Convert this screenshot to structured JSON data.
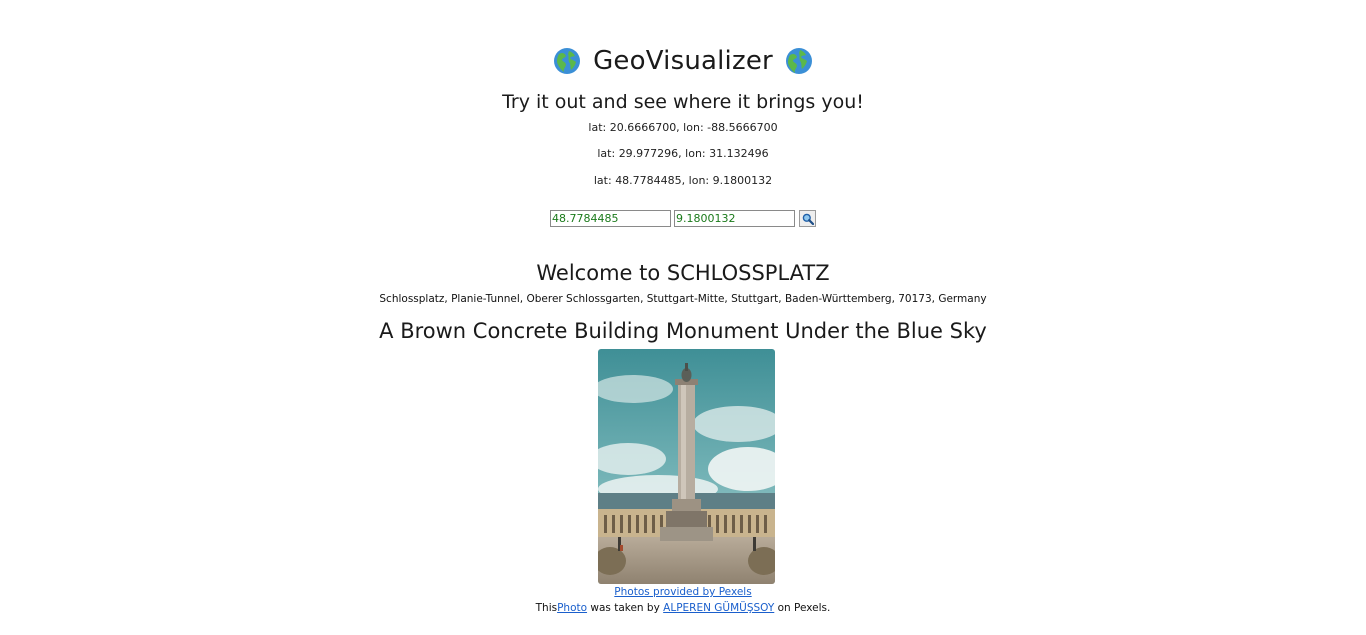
{
  "header": {
    "title": "GeoVisualizer",
    "left_icon": "globe-americas-icon",
    "right_icon": "globe-americas-icon",
    "subtitle": "Try it out and see where it brings you!"
  },
  "sample_coordinates": [
    "lat: 20.6666700, lon: -88.5666700",
    "lat: 29.977296, lon: 31.132496",
    "lat: 48.7784485, lon: 9.1800132"
  ],
  "search": {
    "lat_value": "48.7784485",
    "lon_value": "9.1800132",
    "button_icon": "magnifier-icon"
  },
  "result": {
    "welcome": "Welcome to SCHLOSSPLATZ",
    "address": "Schlossplatz, Planie-Tunnel, Oberer Schlossgarten, Stuttgart-Mitte, Stuttgart, Baden-Württemberg, 70173, Germany",
    "photo_title": "A Brown Concrete Building Monument Under the Blue Sky"
  },
  "credits": {
    "provided_by": "Photos provided by Pexels",
    "this": "This",
    "photo_link": "Photo",
    "was_taken_by": " was taken by ",
    "photographer": "ALPEREN GÜMÜŞSOY",
    "on_pexels": " on Pexels."
  },
  "colors": {
    "link": "#1a5fcc",
    "input_text": "#1b7a1b",
    "sky": "#5fa8ad"
  }
}
